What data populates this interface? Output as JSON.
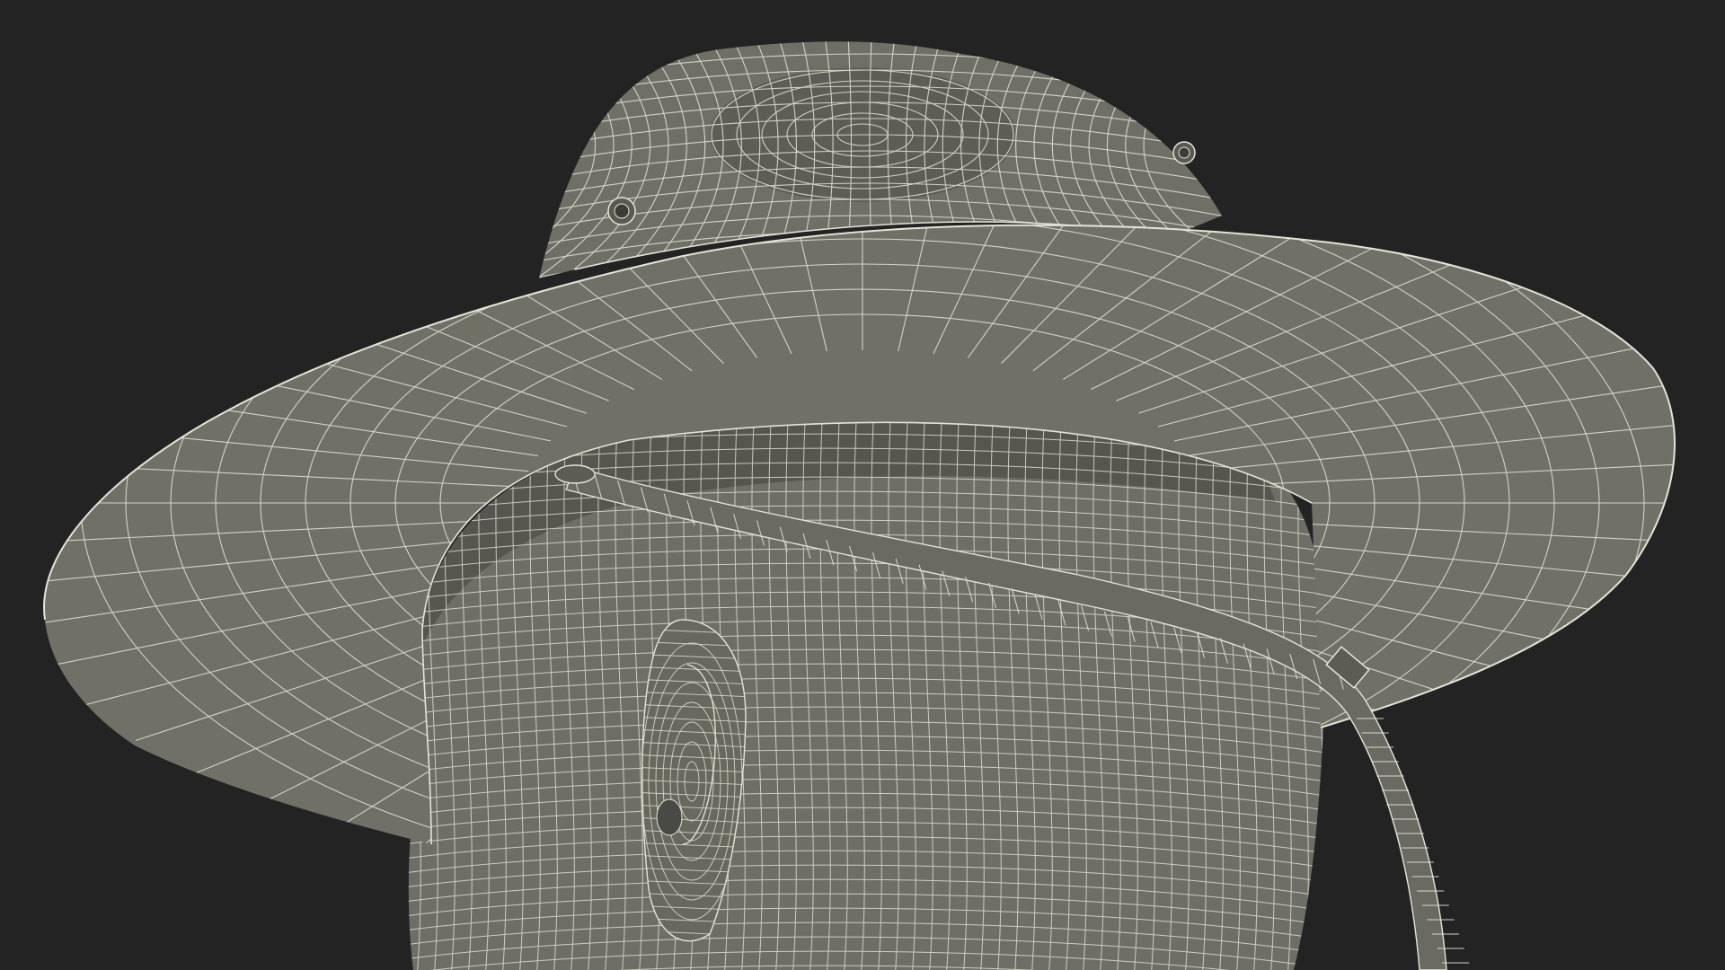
{
  "scene": {
    "subject": "wireframe-render-head-with-bucket-hat",
    "colors": {
      "background": "#232323",
      "surface": "#6f6f66",
      "surface_dark": "#55554d",
      "surface_light": "#7d7d73",
      "wire": "#e4e4d6"
    }
  }
}
